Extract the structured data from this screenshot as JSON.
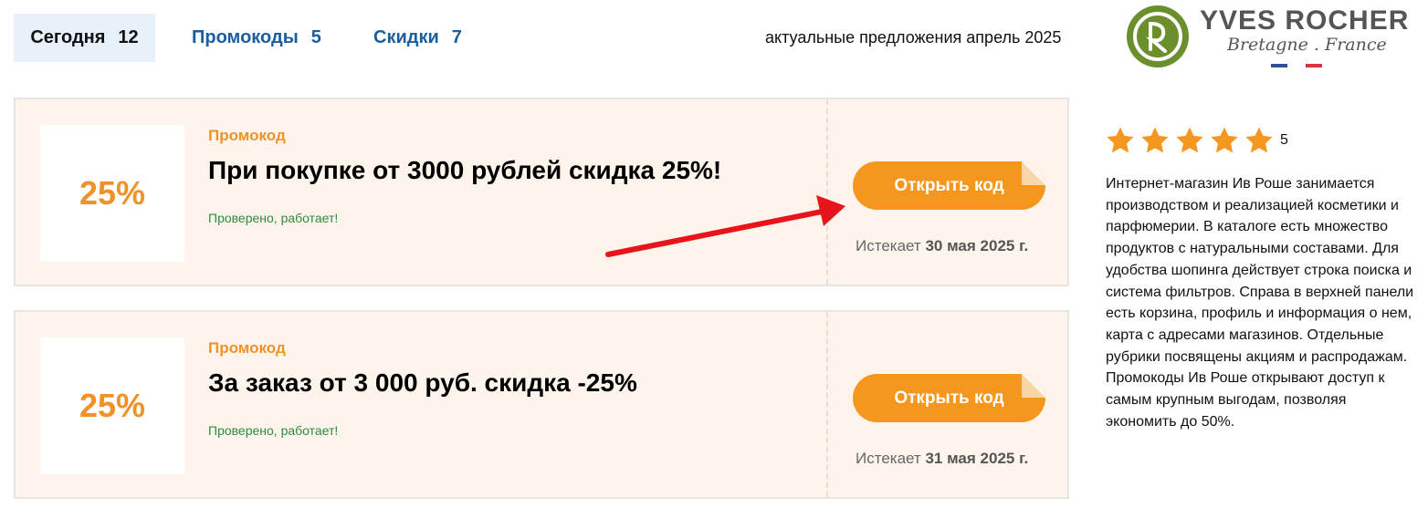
{
  "tabs": [
    {
      "label": "Сегодня",
      "count": "12"
    },
    {
      "label": "Промокоды",
      "count": "5"
    },
    {
      "label": "Скидки",
      "count": "7"
    }
  ],
  "subtitle": "актуальные предложения апрель 2025",
  "brand": {
    "name": "YVES ROCHER",
    "sub": "Bretagne . France",
    "colors": {
      "green": "#6b8f2c",
      "blue": "#2f4e9b",
      "red": "#d6363b"
    }
  },
  "offers": [
    {
      "discount": "25%",
      "type": "Промокод",
      "title": "При покупке от 3000 рублей скидка 25%!",
      "verified": "Проверено, работает!",
      "button": "Открыть код",
      "expires_label": "Истекает",
      "expires_date": "30 мая 2025 г."
    },
    {
      "discount": "25%",
      "type": "Промокод",
      "title": "За заказ от 3 000 руб. скидка -25%",
      "verified": "Проверено, работает!",
      "button": "Открыть код",
      "expires_label": "Истекает",
      "expires_date": "31 мая 2025 г."
    }
  ],
  "rating": {
    "value": "5",
    "stars": 5,
    "star_color": "#f5961f"
  },
  "description": "Интернет-магазин Ив Роше занимается производством и реализацией косметики и парфюмерии. В каталоге есть множество продуктов с натуральными составами. Для удобства шопинга действует строка поиска и система фильтров. Справа в верхней панели есть корзина, профиль и информация о нем, карта с адресами магазинов. Отдельные рубрики посвящены акциям и распродажам. Промокоды Ив Роше открывают доступ к самым крупным выгодам, позволяя экономить до 50%.",
  "colors": {
    "accent": "#f5961f",
    "link": "#1b5ea0",
    "verified": "#2e8b3f",
    "arrow": "#e8141b"
  }
}
